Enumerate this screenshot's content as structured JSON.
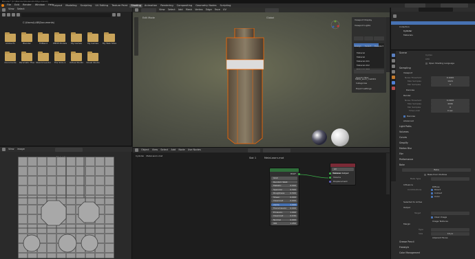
{
  "window": {
    "title": "Blender* [D:\\Blender\\Models\\Doll\\Syo.blend]"
  },
  "menubar": {
    "items": [
      "File",
      "Edit",
      "Render",
      "Window",
      "Help"
    ],
    "workspaces": [
      "Layout",
      "Modeling",
      "Sculpting",
      "UV Editing",
      "Texture Paint",
      "Shading",
      "Animation",
      "Rendering",
      "Compositing",
      "Geometry Nodes",
      "Scripting"
    ],
    "active_workspace": "Shading",
    "scene": "Scene",
    "view_layer": "ViewLayer"
  },
  "file_browser": {
    "header": [
      "View",
      "Select"
    ],
    "path": "C:\\Users\\LAB\\Documents\\",
    "folders": [
      "Adobe Ex",
      "Blender",
      "FXBlend",
      "PMDE Models",
      "My Games",
      "My Games",
      "My Web Sites",
      "Documents",
      "Paramatic Files",
      "SteamInventory",
      "The Sims 4",
      "Virtual Studio",
      "Visual Studio"
    ]
  },
  "viewport": {
    "mode": "Edit Mode",
    "menus": [
      "View",
      "Select",
      "Add",
      "Mesh",
      "Vertex",
      "Edge",
      "Face",
      "UV"
    ],
    "orientation": "Global"
  },
  "sidepanel": {
    "title_items": [
      "Viewport Display",
      "Viewport Lights"
    ],
    "materials": [
      "Material",
      "Material",
      "Material.001",
      "Material.002",
      "Material.003"
    ],
    "selected_material": "Material",
    "material_name": "Metal_worn_mat001",
    "buttons": [
      "Assign",
      "Select",
      "Deselect"
    ],
    "sections": [
      "Search Filter",
      "Categories",
      "Export settings"
    ]
  },
  "outliner": {
    "title": "Scene Collection",
    "items": [
      "Collection",
      "Cylinder",
      "Materials"
    ]
  },
  "properties": {
    "tab_title": "Scene",
    "render_engine": "Cycles",
    "device": "CPU",
    "open_shading_language": "Open Shading Language",
    "sampling_header": "Sampling",
    "viewport_header": "Viewport",
    "noise_threshold_label": "Noise Threshold",
    "noise_threshold": "0.1000",
    "max_samples_label": "Max Samples",
    "viewport_max_samples": "1024",
    "min_samples_label": "Min Samples",
    "min_samples": "0",
    "denoise": "Denoise",
    "render_header": "Render",
    "render_noise_threshold": "0.0100",
    "render_max_samples": "4096",
    "time_limit_label": "Time Limit",
    "time_limit": "0 sec",
    "denoise_checked": "Denoise",
    "advanced": "Advanced",
    "sections": [
      "Light Paths",
      "Volumes",
      "Curves",
      "Simplify",
      "Motion Blur",
      "Film",
      "Performance",
      "Bake"
    ],
    "bake_button": "Bake",
    "bake_from_multires": "Bake from Multires",
    "bake_type_label": "Bake Type",
    "bake_type": "Diffuse",
    "influence_header": "Influence",
    "contributions_label": "Contributions",
    "direct": "Direct",
    "indirect": "Indirect",
    "color": "Color",
    "selected_to_active": "Selected to Active",
    "output_header": "Output",
    "target_label": "Target",
    "target": "Image Textures",
    "clear_image": "Clear Image",
    "margin_header": "Margin",
    "margin_type_label": "Type",
    "margin_type": "Adjacent Faces",
    "margin_size_label": "Size",
    "margin_size": "16 px",
    "bottom_sections": [
      "Grease Pencil",
      "Freestyle",
      "Color Management"
    ]
  },
  "image_editor": {
    "menus": [
      "View",
      "Image"
    ],
    "image_name": "Metal 1 .png"
  },
  "node_editor": {
    "menus": [
      "Object",
      "View",
      "Select",
      "Add",
      "Node",
      "Use Nodes"
    ],
    "object": "Cylinder",
    "material": "Metal-worn-mat",
    "slot": "Slot 1",
    "bsdf": {
      "title": "Principled BSDF",
      "output": "BSDF",
      "fields": [
        [
          "GGX",
          ""
        ],
        [
          "Random Walk",
          ""
        ],
        [
          "Metallic",
          "0.000"
        ],
        [
          "Specular",
          "0.500"
        ],
        [
          "Roughness",
          "0.500"
        ],
        [
          "Sheen",
          "0.000"
        ],
        [
          "Clearcoat",
          "0.000"
        ],
        [
          "Alpha",
          "1.000"
        ],
        [
          "Transmission",
          "0.000"
        ],
        [
          "Emission",
          "1.000"
        ],
        [
          "Clearcoat",
          "0.030"
        ],
        [
          "Normal",
          "0.000"
        ],
        [
          "IOR",
          "1.450"
        ],
        [
          "Subsurface",
          "0.000"
        ]
      ]
    },
    "output": {
      "title": "Material Output",
      "target": "All",
      "sockets": [
        "Surface",
        "Volume",
        "Displacement"
      ]
    }
  }
}
